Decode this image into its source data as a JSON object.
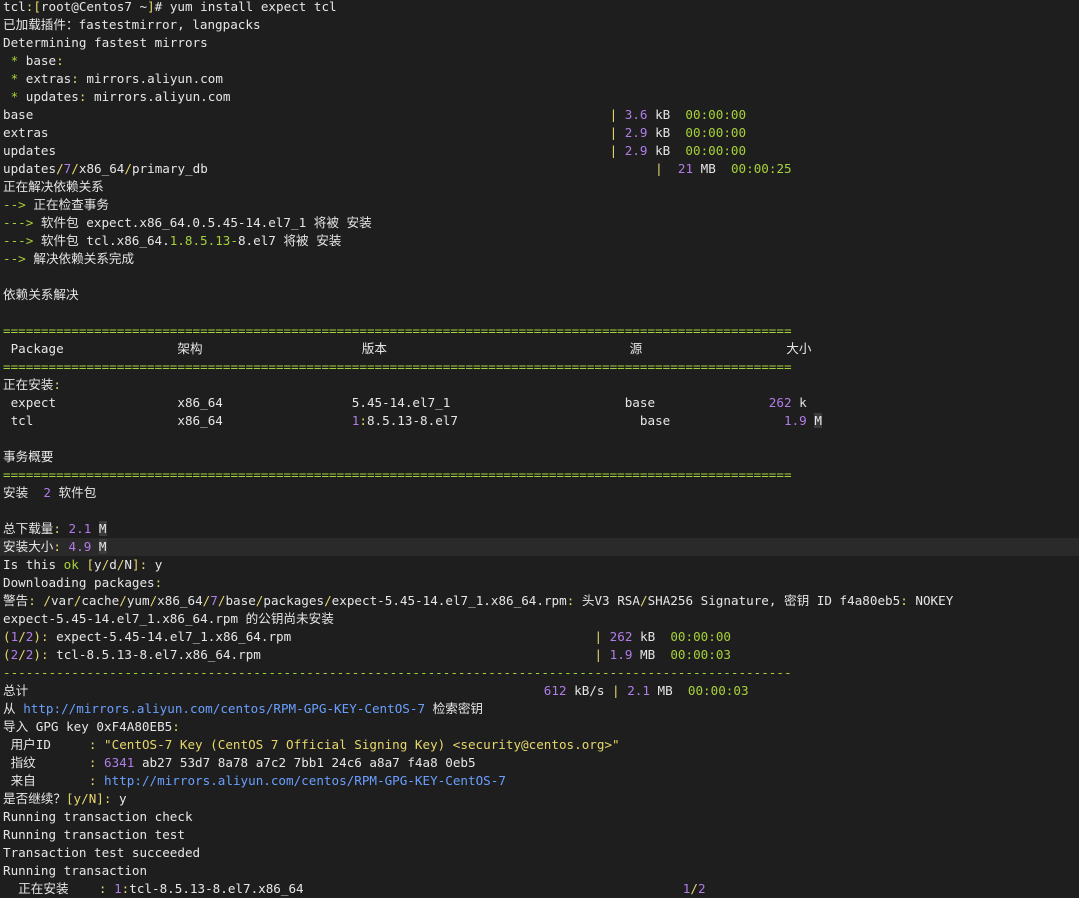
{
  "colors": {
    "background": "#1e1e1e",
    "text": "#e6e6e6",
    "green": "#a7d13a",
    "purple": "#b07de8",
    "yellow": "#e7d76c",
    "blue": "#6a9fff",
    "highlight_row": "#2a2a2a"
  },
  "lines": [
    [
      [
        "w",
        "tcl"
      ],
      [
        "y",
        ":["
      ],
      [
        "w",
        "root@Centos7 ~"
      ],
      [
        "y",
        "]"
      ],
      [
        "w",
        "# yum install expect tcl"
      ]
    ],
    [
      [
        "w",
        "已加载插件：fastestmirror, langpacks"
      ]
    ],
    [
      [
        "w",
        "Determining fastest mirrors"
      ]
    ],
    [
      [
        "g",
        " * "
      ],
      [
        "w",
        "base"
      ],
      [
        "y",
        ":"
      ]
    ],
    [
      [
        "g",
        " * "
      ],
      [
        "w",
        "extras"
      ],
      [
        "y",
        ":"
      ],
      [
        "w",
        " mirrors.aliyun.com"
      ]
    ],
    [
      [
        "g",
        " * "
      ],
      [
        "w",
        "updates"
      ],
      [
        "y",
        ":"
      ],
      [
        "w",
        " mirrors.aliyun.com"
      ]
    ],
    [
      [
        "w",
        "base                                                                            "
      ],
      [
        "y",
        "| "
      ],
      [
        "p",
        "3.6"
      ],
      [
        "w",
        " kB  "
      ],
      [
        "g",
        "00:00:00"
      ]
    ],
    [
      [
        "w",
        "extras                                                                          "
      ],
      [
        "y",
        "| "
      ],
      [
        "p",
        "2.9"
      ],
      [
        "w",
        " kB  "
      ],
      [
        "g",
        "00:00:00"
      ]
    ],
    [
      [
        "w",
        "updates                                                                         "
      ],
      [
        "y",
        "| "
      ],
      [
        "p",
        "2.9"
      ],
      [
        "w",
        " kB  "
      ],
      [
        "g",
        "00:00:00"
      ]
    ],
    [
      [
        "w",
        "updates"
      ],
      [
        "y",
        "/"
      ],
      [
        "p",
        "7"
      ],
      [
        "y",
        "/"
      ],
      [
        "w",
        "x86_64"
      ],
      [
        "y",
        "/"
      ],
      [
        "w",
        "primary_db                                                           "
      ],
      [
        "y",
        "|  "
      ],
      [
        "p",
        "21"
      ],
      [
        "w",
        " MB  "
      ],
      [
        "g",
        "00:00:25"
      ]
    ],
    [
      [
        "w",
        "正在解决依赖关系"
      ]
    ],
    [
      [
        "g",
        "--> "
      ],
      [
        "w",
        "正在检查事务"
      ]
    ],
    [
      [
        "g",
        "---> "
      ],
      [
        "w",
        "软件包 expect.x86_64.0.5.45-14.el7_1 将被 安装"
      ]
    ],
    [
      [
        "g",
        "---> "
      ],
      [
        "w",
        "软件包 tcl.x86_64."
      ],
      [
        "g",
        "1.8.5.13-"
      ],
      [
        "w",
        "8.el7 将被 安装"
      ]
    ],
    [
      [
        "g",
        "--> "
      ],
      [
        "w",
        "解决依赖关系完成"
      ]
    ],
    [],
    [
      [
        "w",
        "依赖关系解决"
      ]
    ],
    [],
    [
      [
        "g",
        "========================================================================================================"
      ]
    ],
    [
      [
        "w",
        " Package               架构                     版本                                源                   大小"
      ]
    ],
    [
      [
        "g",
        "========================================================================================================"
      ]
    ],
    [
      [
        "w",
        "正在安装"
      ],
      [
        "y",
        ":"
      ]
    ],
    [
      [
        "w",
        " expect                x86_64                 5.45-14.el7_1                       base               "
      ],
      [
        "p",
        "262"
      ],
      [
        "w",
        " k"
      ]
    ],
    [
      [
        "w",
        " tcl                   x86_64                 "
      ],
      [
        "p",
        "1"
      ],
      [
        "y",
        ":"
      ],
      [
        "w",
        "8.5.13-8.el7                        base               "
      ],
      [
        "p",
        "1.9"
      ],
      [
        "w",
        " "
      ],
      [
        "cur",
        "M"
      ]
    ],
    [],
    [
      [
        "w",
        "事务概要"
      ]
    ],
    [
      [
        "g",
        "========================================================================================================"
      ]
    ],
    [
      [
        "w",
        "安装  "
      ],
      [
        "p",
        "2"
      ],
      [
        "w",
        " 软件包"
      ]
    ],
    [],
    [
      [
        "w",
        "总下载量"
      ],
      [
        "y",
        ":"
      ],
      [
        "p",
        " 2.1"
      ],
      [
        "w",
        " "
      ],
      [
        "cur",
        "M"
      ]
    ],
    [
      [
        "w",
        "安装大小"
      ],
      [
        "y",
        ":"
      ],
      [
        "p",
        " 4.9"
      ],
      [
        "w",
        " "
      ],
      [
        "cur",
        "M"
      ]
    ],
    [
      [
        "w",
        "Is this "
      ],
      [
        "g",
        "ok"
      ],
      [
        "w",
        " "
      ],
      [
        "y",
        "["
      ],
      [
        "w",
        "y"
      ],
      [
        "y",
        "/"
      ],
      [
        "w",
        "d"
      ],
      [
        "y",
        "/"
      ],
      [
        "w",
        "N"
      ],
      [
        "y",
        "]:"
      ],
      [
        "w",
        " y"
      ]
    ],
    [
      [
        "w",
        "Downloading packages"
      ],
      [
        "y",
        ":"
      ]
    ],
    [
      [
        "w",
        "警告"
      ],
      [
        "y",
        ":"
      ],
      [
        "w",
        " "
      ],
      [
        "y",
        "/"
      ],
      [
        "w",
        "var"
      ],
      [
        "y",
        "/"
      ],
      [
        "w",
        "cache"
      ],
      [
        "y",
        "/"
      ],
      [
        "w",
        "yum"
      ],
      [
        "y",
        "/"
      ],
      [
        "w",
        "x86_64"
      ],
      [
        "y",
        "/"
      ],
      [
        "p",
        "7"
      ],
      [
        "y",
        "/"
      ],
      [
        "w",
        "base"
      ],
      [
        "y",
        "/"
      ],
      [
        "w",
        "packages"
      ],
      [
        "y",
        "/"
      ],
      [
        "w",
        "expect-5.45-14.el7_1.x86_64.rpm"
      ],
      [
        "y",
        ":"
      ],
      [
        "w",
        " 头V3 RSA"
      ],
      [
        "y",
        "/"
      ],
      [
        "w",
        "SHA256 Signature, 密钥 ID f4a80eb5"
      ],
      [
        "y",
        ":"
      ],
      [
        "w",
        " NOKEY"
      ]
    ],
    [
      [
        "w",
        "expect-5.45-14.el7_1.x86_64.rpm 的公钥尚未安装"
      ]
    ],
    [
      [
        "y",
        "("
      ],
      [
        "p",
        "1"
      ],
      [
        "y",
        "/"
      ],
      [
        "p",
        "2"
      ],
      [
        "y",
        ")"
      ],
      [
        "y",
        ":"
      ],
      [
        "w",
        " expect-5.45-14.el7_1.x86_64.rpm                                        "
      ],
      [
        "y",
        "| "
      ],
      [
        "p",
        "262"
      ],
      [
        "w",
        " kB  "
      ],
      [
        "g",
        "00:00:00"
      ]
    ],
    [
      [
        "y",
        "("
      ],
      [
        "p",
        "2"
      ],
      [
        "y",
        "/"
      ],
      [
        "p",
        "2"
      ],
      [
        "y",
        ")"
      ],
      [
        "y",
        ":"
      ],
      [
        "w",
        " tcl-8.5.13-8.el7.x86_64.rpm                                            "
      ],
      [
        "y",
        "| "
      ],
      [
        "p",
        "1.9"
      ],
      [
        "w",
        " MB  "
      ],
      [
        "g",
        "00:00:03"
      ]
    ],
    [
      [
        "g",
        "--------------------------------------------------------------------------------------------------------"
      ]
    ],
    [
      [
        "w",
        "总计                                                                    "
      ],
      [
        "p",
        "612"
      ],
      [
        "w",
        " kB/s "
      ],
      [
        "y",
        "| "
      ],
      [
        "p",
        "2.1"
      ],
      [
        "w",
        " MB  "
      ],
      [
        "g",
        "00:00:03"
      ]
    ],
    [
      [
        "w",
        "从 "
      ],
      [
        "b",
        "http://mirrors.aliyun.com/centos/RPM-GPG-KEY-CentOS-7"
      ],
      [
        "w",
        " 检索密钥"
      ]
    ],
    [
      [
        "w",
        "导入 GPG key 0xF4A80EB5"
      ],
      [
        "y",
        ":"
      ]
    ],
    [
      [
        "w",
        " 用户ID     "
      ],
      [
        "y",
        ":"
      ],
      [
        "y",
        " \"CentOS-7 Key (CentOS 7 Official Signing Key) <security@centos.org>\""
      ]
    ],
    [
      [
        "w",
        " 指纹       "
      ],
      [
        "y",
        ":"
      ],
      [
        "w",
        " "
      ],
      [
        "p",
        "6341"
      ],
      [
        "w",
        " ab27 53d7 8a78 a7c2 7bb1 24c6 a8a7 f4a8 0eb5"
      ]
    ],
    [
      [
        "w",
        " 来自       "
      ],
      [
        "y",
        ":"
      ],
      [
        "w",
        " "
      ],
      [
        "b",
        "http://mirrors.aliyun.com/centos/RPM-GPG-KEY-CentOS-7"
      ]
    ],
    [
      [
        "w",
        "是否继续？"
      ],
      [
        "y",
        "[y/N]:"
      ],
      [
        "w",
        " y"
      ]
    ],
    [
      [
        "w",
        "Running transaction check"
      ]
    ],
    [
      [
        "w",
        "Running transaction test"
      ]
    ],
    [
      [
        "w",
        "Transaction test succeeded"
      ]
    ],
    [
      [
        "w",
        "Running transaction"
      ]
    ],
    [
      [
        "w",
        "  正在安装    "
      ],
      [
        "y",
        ":"
      ],
      [
        "w",
        " "
      ],
      [
        "p",
        "1"
      ],
      [
        "y",
        ":"
      ],
      [
        "w",
        "tcl-8.5.13-8.el7.x86_64                                                  "
      ],
      [
        "p",
        "1"
      ],
      [
        "y",
        "/"
      ],
      [
        "p",
        "2"
      ]
    ]
  ]
}
